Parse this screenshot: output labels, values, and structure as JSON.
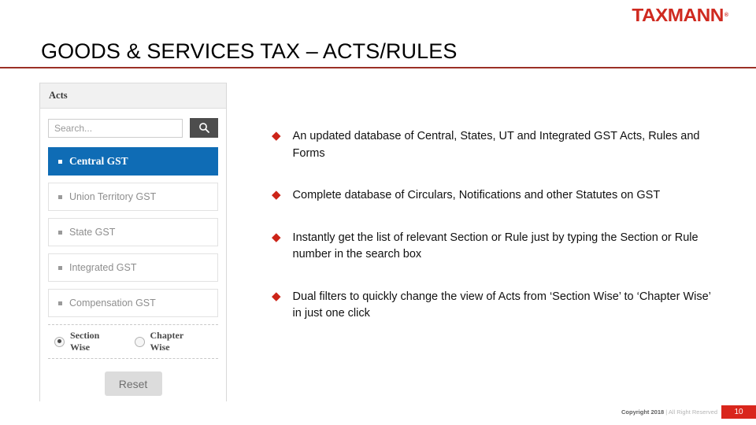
{
  "brand": {
    "logo_text": "TAXMANN",
    "trademark": "®",
    "color": "#cf2a20"
  },
  "title": {
    "text": "GOODS & SERVICES TAX – ACTS/RULES",
    "rule_color": "#9b3025"
  },
  "acts_panel": {
    "header": "Acts",
    "search": {
      "placeholder": "Search...",
      "value": "",
      "button_icon": "search-icon"
    },
    "items": [
      {
        "label": "Central GST",
        "selected": true
      },
      {
        "label": "Union Territory GST",
        "selected": false
      },
      {
        "label": "State GST",
        "selected": false
      },
      {
        "label": "Integrated GST",
        "selected": false
      },
      {
        "label": "Compensation GST",
        "selected": false
      }
    ],
    "view_filter": {
      "options": [
        {
          "label": "Section Wise",
          "checked": true
        },
        {
          "label": "Chapter Wise",
          "checked": false
        }
      ]
    },
    "reset_label": "Reset",
    "selected_color": "#0f6cb5"
  },
  "bullets": {
    "marker": "◆",
    "marker_color": "#cc2418",
    "items": [
      "An updated database of Central, States, UT and Integrated GST Acts, Rules and Forms",
      "Complete database of Circulars, Notifications and other Statutes on GST",
      "Instantly get the list of relevant Section or Rule just by typing the Section or Rule number in the search box",
      "Dual filters to quickly change the view of Acts from ‘Section Wise’ to ‘Chapter Wise’ in just one click"
    ]
  },
  "footer": {
    "copyright_bold": "Copyright 2018",
    "copyright_light": "| All Right Reserved",
    "page_number": "10",
    "page_number_color": "#d9261c"
  }
}
